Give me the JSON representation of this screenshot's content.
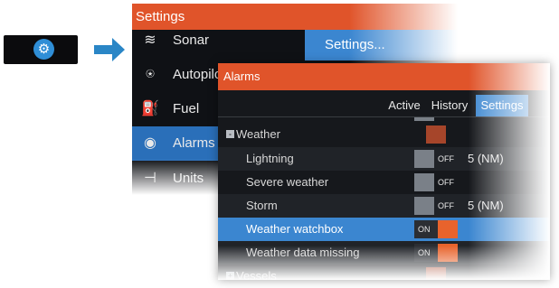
{
  "gear_key": {
    "icon": "gear-icon"
  },
  "settings_panel": {
    "title": "Settings",
    "items": [
      {
        "label": "Sonar",
        "icon": "sonar-icon"
      },
      {
        "label": "Autopilot",
        "icon": "autopilot-icon"
      },
      {
        "label": "Fuel",
        "icon": "fuel-icon"
      },
      {
        "label": "Alarms",
        "icon": "alarms-icon",
        "selected": true
      },
      {
        "label": "Units",
        "icon": "units-icon"
      }
    ],
    "popup": "Settings..."
  },
  "alarms_panel": {
    "title": "Alarms",
    "tabs": [
      "Active",
      "History",
      "Settings"
    ],
    "groups": {
      "weather": "Weather",
      "vessels": "Vessels"
    },
    "rows": [
      {
        "label": "Lightning",
        "state": "OFF",
        "value": "5 (NM)"
      },
      {
        "label": "Severe weather",
        "state": "OFF",
        "value": ""
      },
      {
        "label": "Storm",
        "state": "OFF",
        "value": "5 (NM)"
      },
      {
        "label": "Weather watchbox",
        "state": "ON",
        "value": ""
      },
      {
        "label": "Weather data missing",
        "state": "ON",
        "value": ""
      }
    ]
  },
  "colors": {
    "accent": "#e0542a",
    "selection": "#3b86d0",
    "toggle_on": "#e8632c"
  }
}
